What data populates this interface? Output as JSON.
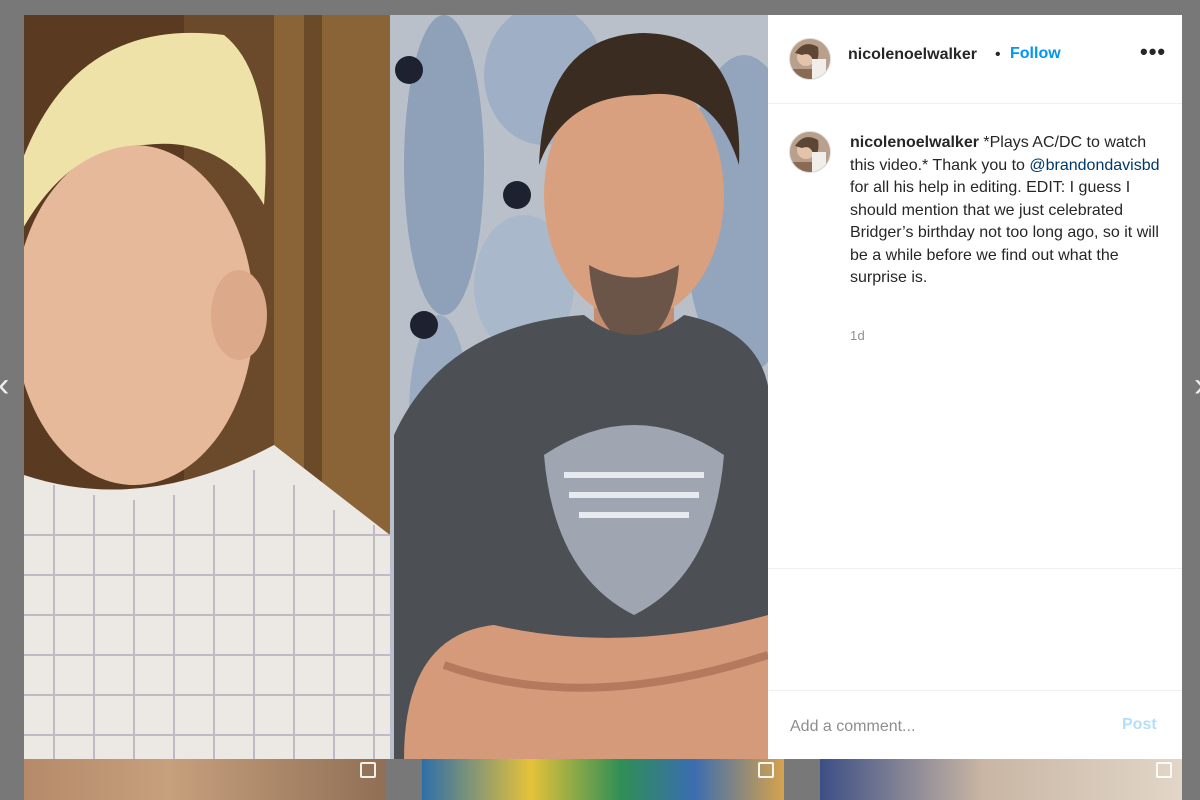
{
  "post": {
    "username": "nicolenoelwalker",
    "separator": "•",
    "follow_label": "Follow",
    "more_label": "•••",
    "caption": {
      "username": "nicolenoelwalker",
      "text_before": " *Plays AC/DC to watch this video.* Thank you to ",
      "mention": "@brandondavisbd",
      "text_after": " for all his help in editing. EDIT: I guess I should mention that we just celebrated Bridger’s birthday not too long ago, so it will be a while before we find out what the surprise is."
    },
    "timestamp": "1d",
    "comment_placeholder": "Add a comment...",
    "post_label": "Post"
  },
  "navigation": {
    "prev_glyph": "‹",
    "next_glyph": "›"
  },
  "colors": {
    "follow": "#0095f6",
    "mention": "#00376b",
    "post_disabled": "#b2dffc"
  }
}
